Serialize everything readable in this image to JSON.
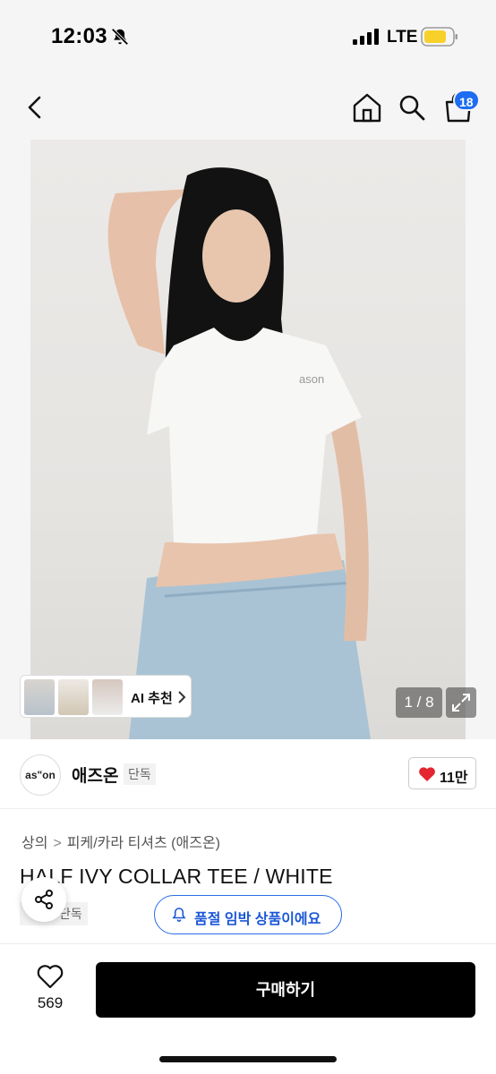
{
  "status": {
    "time": "12:03",
    "network": "LTE"
  },
  "header": {
    "cart_count": "18"
  },
  "gallery": {
    "ai_recommend_label": "AI 추천",
    "page_counter": "1 / 8"
  },
  "brand": {
    "logo_text": "as\"on",
    "name": "애즈온",
    "exclusive_tag": "단독",
    "like_count": "11만"
  },
  "product": {
    "breadcrumb": [
      "상의",
      "피케/카라 티셔츠 (애즈온)"
    ],
    "title": "HALF IVY COLLAR TEE / WHITE",
    "exclusive_tag": "단독",
    "restock_label": "품절 임박 상품이에요"
  },
  "bottom": {
    "wish_count": "569",
    "buy_label": "구매하기"
  },
  "colors": {
    "accent_blue": "#1e6cf2",
    "like_red": "#e3262f",
    "buy_black": "#000000"
  }
}
